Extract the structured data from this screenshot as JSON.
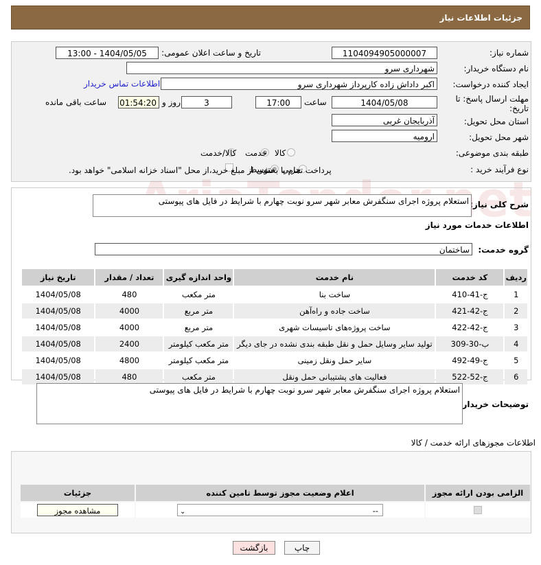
{
  "header": {
    "title": "جزئیات اطلاعات نیاز"
  },
  "info": {
    "need_number_label": "شماره نیاز:",
    "need_number": "1104094905000007",
    "announce_label": "تاریخ و ساعت اعلان عمومی:",
    "announce_value": "1404/05/05 - 13:00",
    "buyer_label": "نام دستگاه خریدار:",
    "buyer": "شهرداری سرو",
    "creator_label": "ایجاد کننده درخواست:",
    "creator": "اکبر داداش زاده کارپرداز شهرداری سرو",
    "contact_link": "اطلاعات تماس خریدار",
    "deadline_label": "مهلت ارسال پاسخ: تا تاریخ:",
    "deadline_date": "1404/05/08",
    "time_label": "ساعت",
    "deadline_time": "17:00",
    "days": "3",
    "days_label": "روز و",
    "remaining": "01:54:20",
    "remaining_label": "ساعت باقی مانده",
    "province_label": "استان محل تحویل:",
    "province": "آذربایجان غربی",
    "city_label": "شهر محل تحویل:",
    "city": "ارومیه",
    "category_label": "طبقه بندی موضوعی:",
    "category_options": [
      "کالا",
      "خدمت",
      "کالا/خدمت"
    ],
    "category_selected": "خدمت",
    "process_label": "نوع فرآیند خرید :",
    "process_options": [
      "جزیی",
      "متوسط"
    ],
    "process_selected": "متوسط",
    "payment_note": "پرداخت تمام یا بخشی از مبلغ خرید،از محل \"اسناد خزانه اسلامی\" خواهد بود."
  },
  "summary": {
    "label": "شرح کلی نیاز:",
    "value": "استعلام پروژه اجرای سنگفرش معابر شهر سرو نوبت چهارم با شرایط در فایل های پیوستی"
  },
  "services": {
    "title": "اطلاعات خدمات مورد نیاز",
    "group_label": "گروه خدمت:",
    "group": "ساختمان",
    "headers": [
      "ردیف",
      "کد خدمت",
      "نام خدمت",
      "واحد اندازه گیری",
      "تعداد / مقدار",
      "تاریخ نیاز"
    ],
    "rows": [
      [
        "1",
        "ج-41-410",
        "ساخت بنا",
        "متر مکعب",
        "480",
        "1404/05/08"
      ],
      [
        "2",
        "ج-42-421",
        "ساخت جاده و راه‌آهن",
        "متر مربع",
        "4000",
        "1404/05/08"
      ],
      [
        "3",
        "ج-42-422",
        "ساخت پروژه‌های تاسیسات شهری",
        "متر مربع",
        "4000",
        "1404/05/08"
      ],
      [
        "4",
        "ب-30-309",
        "تولید سایر وسایل حمل و نقل طبقه بندی نشده در جای دیگر",
        "متر مکعب کیلومتر",
        "2400",
        "1404/05/08"
      ],
      [
        "5",
        "ج-49-492",
        "سایر حمل ونقل زمینی",
        "متر مکعب کیلومتر",
        "4800",
        "1404/05/08"
      ],
      [
        "6",
        "ج-52-522",
        "فعالیت های پشتیبانی حمل ونقل",
        "متر مکعب",
        "480",
        "1404/05/08"
      ]
    ]
  },
  "buyer_notes": {
    "label": "توضیحات خریدار:",
    "value": "استعلام پروژه اجرای سنگفرش معابر شهر سرو نوبت چهارم با شرایط در فایل های پیوستی"
  },
  "permits": {
    "title": "اطلاعات مجوزهای ارائه خدمت / کالا",
    "headers": [
      "الزامی بودن ارائه مجوز",
      "اعلام وضعیت مجوز توسط تامین کننده",
      "جزئیات"
    ],
    "select_value": "--",
    "view_button": "مشاهده مجوز"
  },
  "buttons": {
    "print": "چاپ",
    "back": "بازگشت"
  },
  "watermark": "AriaTender.net"
}
